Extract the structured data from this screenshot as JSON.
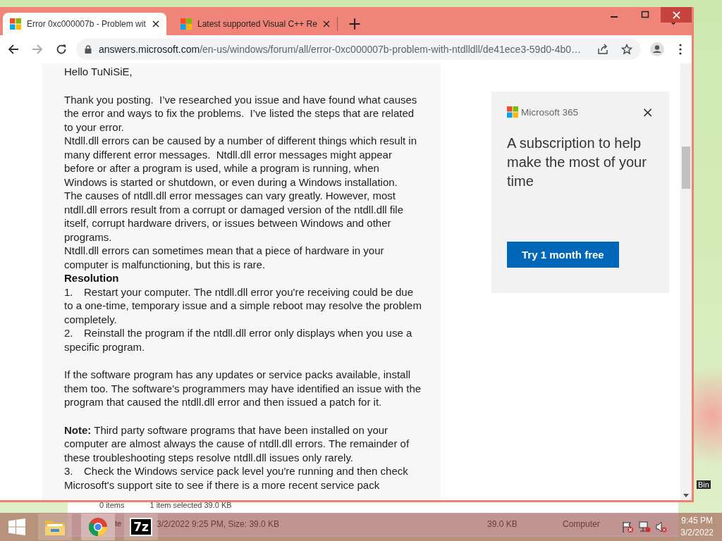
{
  "browser": {
    "tabs": [
      {
        "title": "Error 0xc000007b - Problem wit",
        "selected": true
      },
      {
        "title": "Latest supported Visual C++ Re",
        "selected": false
      }
    ],
    "new_tab": "+",
    "address": {
      "host": "answers.microsoft.com",
      "path": "/en-us/windows/forum/all/error-0xc000007b-problem-with-ntdlldll/de41ece3-59d0-4b0…"
    }
  },
  "article": [
    [
      {
        "kind": "text",
        "text": "Hello TuNiSiE,"
      }
    ],
    [
      {
        "kind": "text",
        "text": "Thank you posting.  I’ve researched you issue and have found what causes the error and ways to fix the problems.  I’ve listed the steps that are related to your error."
      },
      {
        "kind": "text",
        "text": "Ntdll.dll errors can be caused by a number of different things which result in many different error messages.  Ntdll.dll error messages might appear before or after a program is used, while a program is running, when Windows is started or shutdown, or even during a Windows installation."
      },
      {
        "kind": "text",
        "text": "The causes of ntdll.dll error messages can vary greatly. However, most ntdll.dll errors result from a corrupt or damaged version of the ntdll.dll file itself, corrupt hardware drivers, or issues between Windows and other programs."
      },
      {
        "kind": "text",
        "text": "Ntdll.dll errors can sometimes mean that a piece of hardware in your computer is malfunctioning, but this is rare."
      },
      {
        "kind": "heading",
        "text": "Resolution"
      },
      {
        "kind": "step",
        "number": "1.",
        "text": "Restart your computer. The ntdll.dll error you're receiving could be due to a one-time, temporary issue and a simple reboot may resolve the problem completely."
      },
      {
        "kind": "step",
        "number": "2.",
        "text": "Reinstall the program if the ntdll.dll error only displays when you use a specific program."
      }
    ],
    [
      {
        "kind": "text",
        "text": "If the software program has any updates or service packs available, install them too. The software's programmers may have identified an issue with the program that caused the ntdll.dll error and then issued a patch for it."
      }
    ],
    [
      {
        "kind": "text",
        "text": "**Note:** Third party software programs that have been installed on your computer are almost always the cause of ntdll.dll errors. The remainder of these troubleshooting steps resolve ntdll.dll issues only rarely."
      },
      {
        "kind": "step",
        "number": "3.",
        "text": "Check the Windows service pack level you're running and then check Microsoft's support site to see if there is a more recent service pack"
      }
    ]
  ],
  "ad": {
    "brand": "Microsoft 365",
    "close": "×",
    "headline": "A subscription to help make the most of your time",
    "button": "Try 1 month free"
  },
  "explorer": {
    "status": [
      "0 items",
      "1 item selected  39.0 KB"
    ],
    "details": [
      "te",
      "3/2/2022 9:25 PM, Size: 39.0 KB",
      "39.0 KB",
      "Computer"
    ]
  },
  "taskbar": {
    "apps": [
      {
        "kind": "folder"
      },
      {
        "kind": "chrome"
      },
      {
        "kind": "archiver",
        "label": "7z"
      }
    ],
    "time": "9:45 PM",
    "date": "3/2/2022"
  },
  "desktop": {
    "icon_label": "Bin"
  }
}
